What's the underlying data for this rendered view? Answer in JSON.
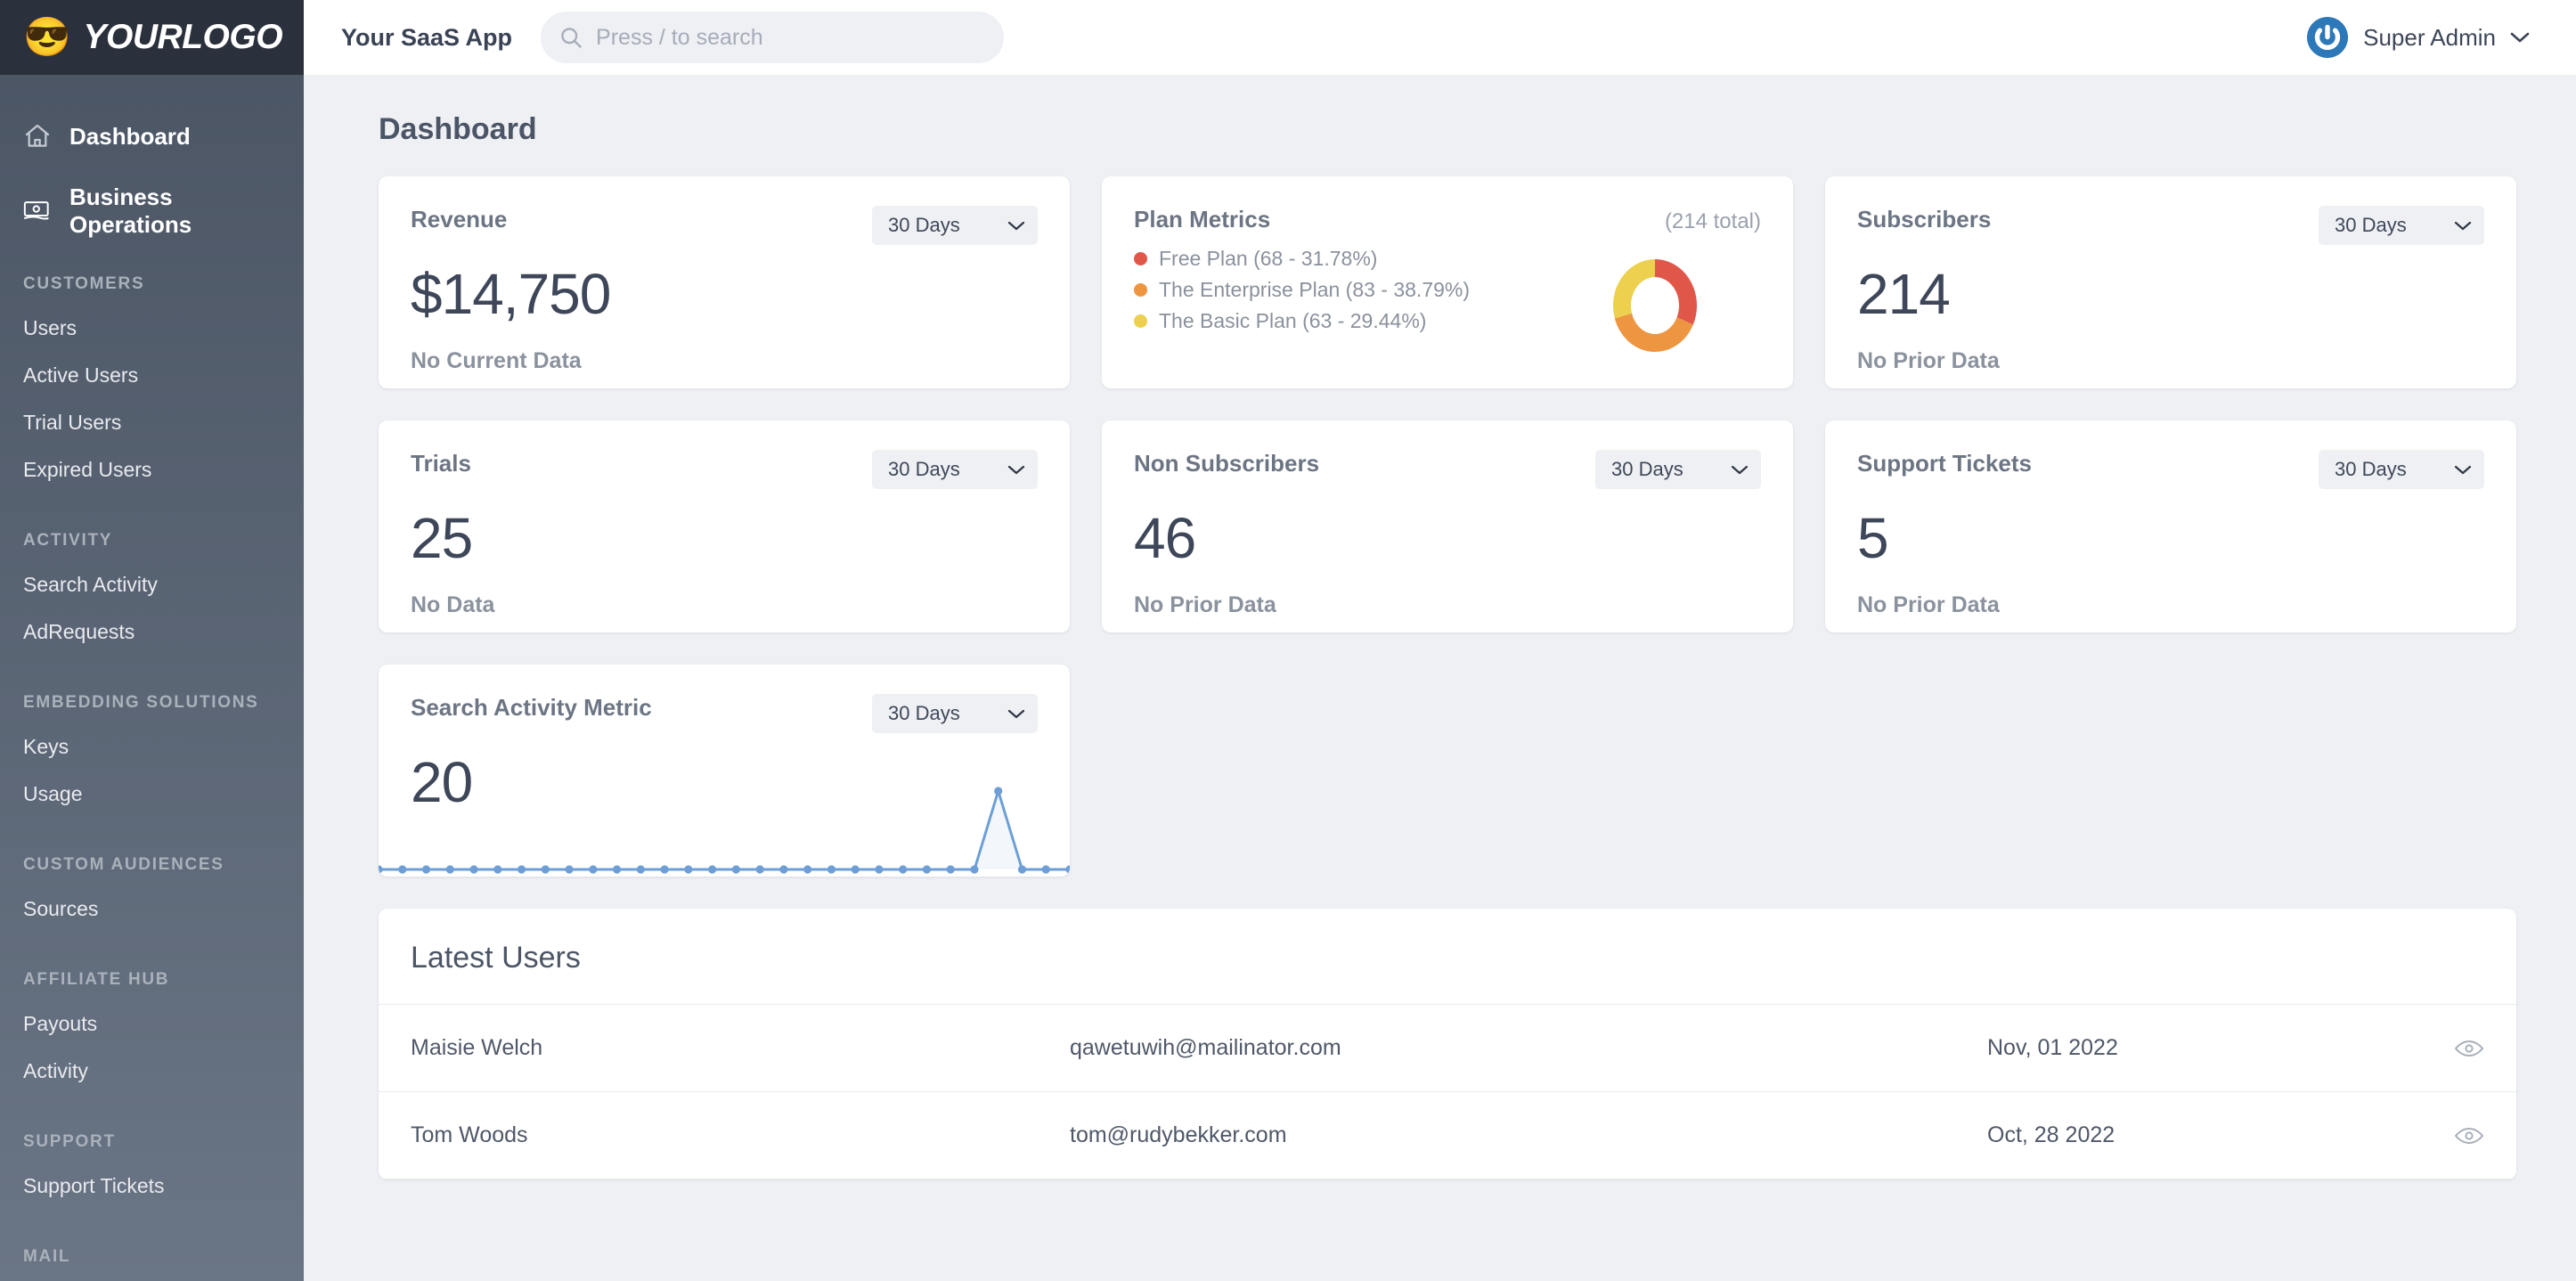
{
  "brand": {
    "logo_emoji": "😎",
    "logo_text": "YOURLOGO",
    "logo_bg": "#2b313c"
  },
  "sidebar": {
    "main_items": [
      {
        "label": "Dashboard",
        "icon": "home-icon"
      },
      {
        "label": "Business Operations",
        "icon": "banknote-icon"
      }
    ],
    "groups": [
      {
        "title": "CUSTOMERS",
        "items": [
          "Users",
          "Active Users",
          "Trial Users",
          "Expired Users"
        ]
      },
      {
        "title": "ACTIVITY",
        "items": [
          "Search Activity",
          "AdRequests"
        ]
      },
      {
        "title": "EMBEDDING SOLUTIONS",
        "items": [
          "Keys",
          "Usage"
        ]
      },
      {
        "title": "CUSTOM AUDIENCES",
        "items": [
          "Sources"
        ]
      },
      {
        "title": "AFFILIATE HUB",
        "items": [
          "Payouts",
          "Activity"
        ]
      },
      {
        "title": "SUPPORT",
        "items": [
          "Support Tickets"
        ]
      },
      {
        "title": "MAIL",
        "items": []
      }
    ]
  },
  "topbar": {
    "app_title": "Your SaaS App",
    "search_placeholder": "Press / to search",
    "search_value": "",
    "search_icon": "search-icon",
    "user_name": "Super Admin",
    "avatar_icon": "power-avatar-icon",
    "chevron_icon": "chevron-down-icon",
    "avatar_color": "#2c78b8"
  },
  "page": {
    "title": "Dashboard"
  },
  "cards": {
    "revenue": {
      "title": "Revenue",
      "value": "$14,750",
      "note": "No Current Data",
      "range": "30 Days"
    },
    "plan_metrics": {
      "title": "Plan Metrics",
      "total_label": "(214 total)"
    },
    "subscribers": {
      "title": "Subscribers",
      "value": "214",
      "note": "No Prior Data",
      "range": "30 Days"
    },
    "trials": {
      "title": "Trials",
      "value": "25",
      "note": "No Data",
      "range": "30 Days"
    },
    "non_subscribers": {
      "title": "Non Subscribers",
      "value": "46",
      "note": "No Prior Data",
      "range": "30 Days"
    },
    "support_tickets": {
      "title": "Support Tickets",
      "value": "5",
      "note": "No Prior Data",
      "range": "30 Days"
    },
    "search_activity": {
      "title": "Search Activity Metric",
      "value": "20",
      "range": "30 Days"
    }
  },
  "latest_users": {
    "title": "Latest Users",
    "rows": [
      {
        "name": "Maisie Welch",
        "email": "qawetuwih@mailinator.com",
        "date": "Nov, 01 2022",
        "action_icon": "eye-icon"
      },
      {
        "name": "Tom Woods",
        "email": "tom@rudybekker.com",
        "date": "Oct, 28 2022",
        "action_icon": "eye-icon"
      }
    ]
  },
  "chart_data": [
    {
      "type": "pie",
      "title": "Plan Metrics",
      "subtitle": "(214 total)",
      "total": 214,
      "legend_position": "left",
      "categories": [
        "Free Plan",
        "The Enterprise Plan",
        "The Basic Plan"
      ],
      "values": [
        68,
        83,
        63
      ],
      "percents": [
        31.78,
        38.79,
        29.44
      ],
      "colors": [
        "#e0574a",
        "#ed9540",
        "#ecd04e"
      ],
      "legend_entries": [
        "Free Plan (68 - 31.78%)",
        "The Enterprise Plan (83 - 38.79%)",
        "The Basic Plan (63 - 29.44%)"
      ]
    },
    {
      "type": "line",
      "title": "Search Activity Metric",
      "xlabel": "",
      "ylabel": "",
      "grid": false,
      "legend_position": "none",
      "color": "#6d9fd6",
      "fill": "#f3f7fc",
      "ylim": [
        0,
        20
      ],
      "x": [
        1,
        2,
        3,
        4,
        5,
        6,
        7,
        8,
        9,
        10,
        11,
        12,
        13,
        14,
        15,
        16,
        17,
        18,
        19,
        20,
        21,
        22,
        23,
        24,
        25,
        26,
        27,
        28,
        29,
        30
      ],
      "values": [
        0,
        0,
        0,
        0,
        0,
        0,
        0,
        0,
        0,
        0,
        0,
        0,
        0,
        0,
        0,
        0,
        0,
        0,
        0,
        0,
        0,
        0,
        0,
        0,
        0,
        0,
        20,
        0,
        0,
        0
      ]
    }
  ]
}
